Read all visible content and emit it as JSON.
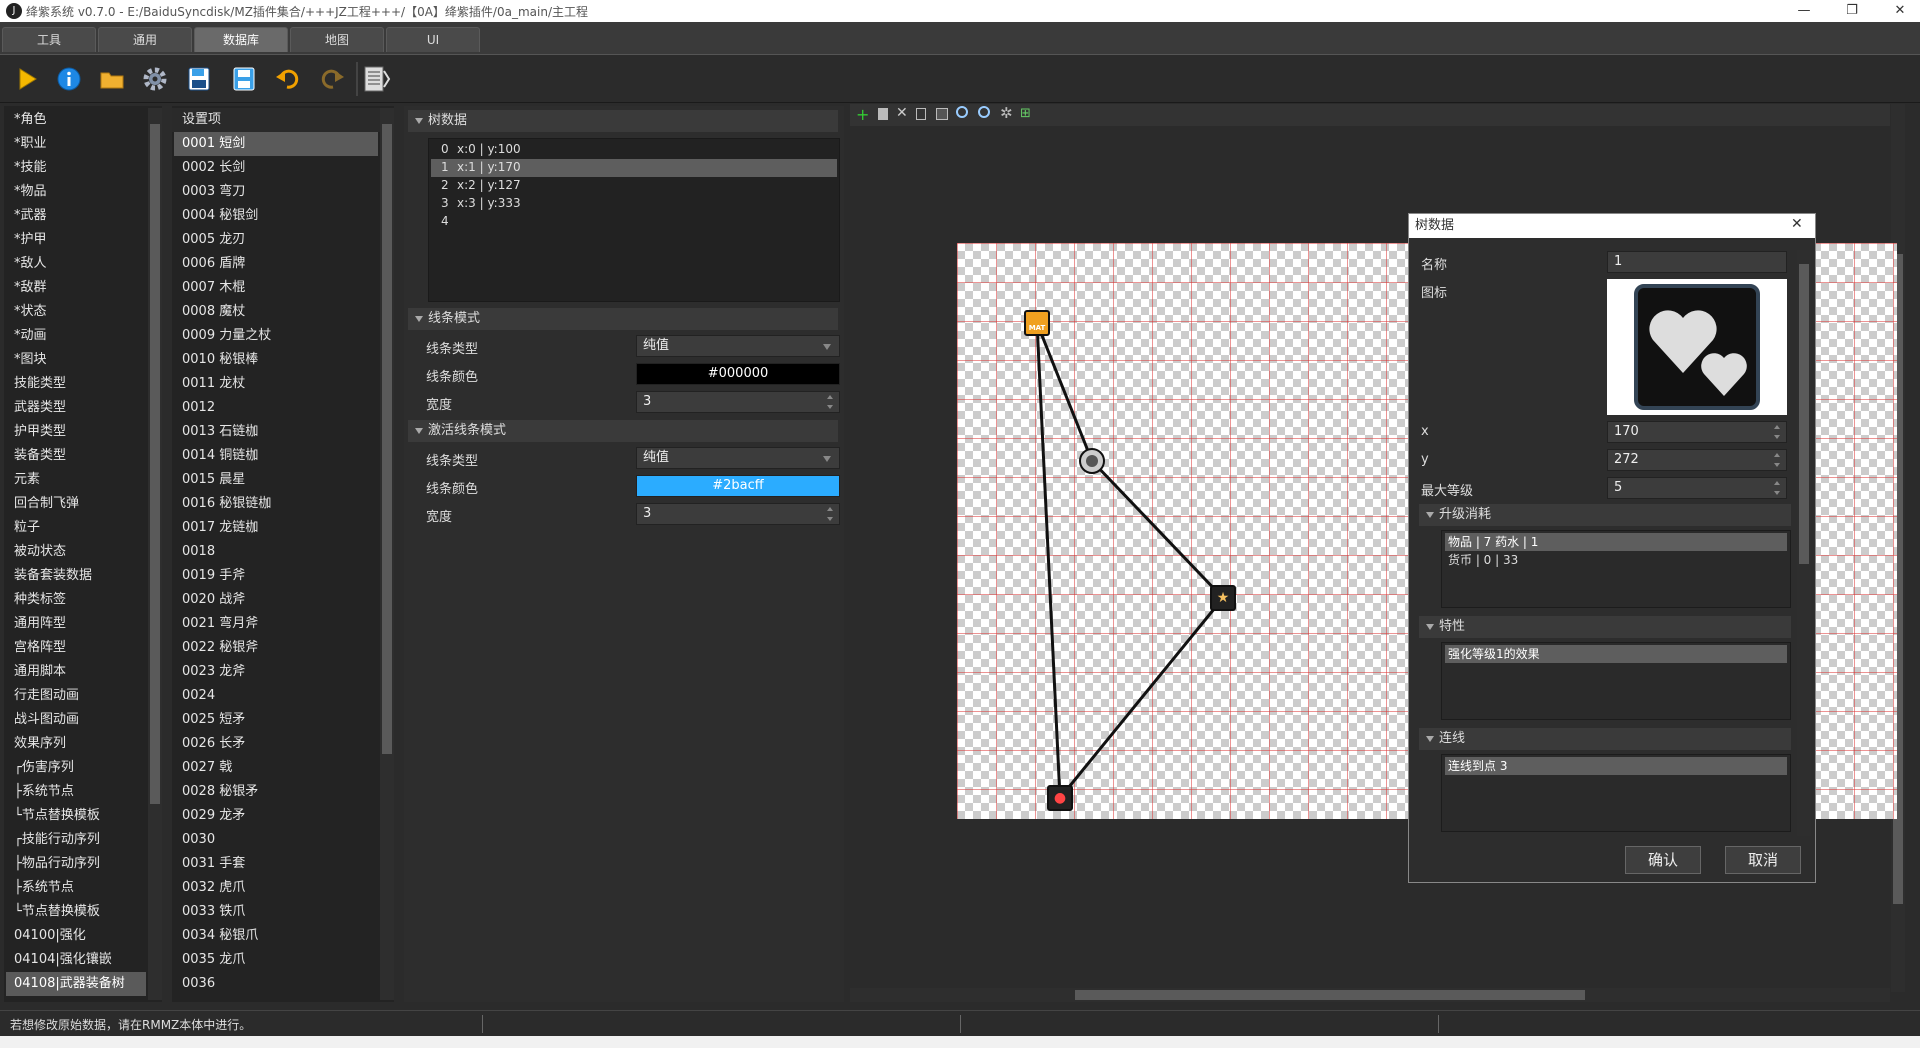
{
  "window": {
    "title": "绛紫系统 v0.7.0 - E:/BaiduSyncdisk/MZ插件集合/+++JZ工程+++/【0A】绛紫插件/0a_main/主工程",
    "logo_text": "J",
    "minimize": "—",
    "maximize": "❐",
    "close": "✕"
  },
  "tabs": [
    {
      "label": "工具",
      "active": false
    },
    {
      "label": "通用",
      "active": false
    },
    {
      "label": "数据库",
      "active": true
    },
    {
      "label": "地图",
      "active": false
    },
    {
      "label": "UI",
      "active": false
    }
  ],
  "toolbar": {
    "icons": [
      "play-icon",
      "info-icon",
      "folder-icon",
      "gear-icon",
      "save-as-icon",
      "save-icon",
      "undo-icon",
      "redo-icon",
      "script-icon"
    ],
    "colors": {
      "play": "#f5b800",
      "info": "#1e88e5",
      "folder": "#f0b030",
      "gear": "#b0b8c8",
      "save": "#3aa0e8",
      "undo": "#f0a000"
    }
  },
  "categories": [
    "*角色",
    "*职业",
    "*技能",
    "*物品",
    "*武器",
    "*护甲",
    "*敌人",
    "*敌群",
    "*状态",
    "*动画",
    "*图块",
    "技能类型",
    "武器类型",
    "护甲类型",
    "装备类型",
    "元素",
    "回合制飞弹",
    "粒子",
    "被动状态",
    "装备套装数据",
    "种类标签",
    "通用阵型",
    "宫格阵型",
    "通用脚本",
    "行走图动画",
    "战斗图动画",
    "效果序列",
    "┌伤害序列",
    "├系统节点",
    "└节点替换模板",
    "┌技能行动序列",
    "├物品行动序列",
    "├系统节点",
    "└节点替换模板",
    "04100|强化",
    "04104|强化镶嵌",
    "04108|武器装备树"
  ],
  "categories_selected": 36,
  "settings": {
    "header": "设置项",
    "items": [
      "0001  短剑",
      "0002  长剑",
      "0003  弯刀",
      "0004  秘银剑",
      "0005  龙刃",
      "0006  盾牌",
      "0007  木棍",
      "0008  魔杖",
      "0009  力量之杖",
      "0010  秘银棒",
      "0011  龙杖",
      "0012",
      "0013  石链枷",
      "0014  铜链枷",
      "0015  晨星",
      "0016  秘银链枷",
      "0017  龙链枷",
      "0018",
      "0019  手斧",
      "0020  战斧",
      "0021  弯月斧",
      "0022  秘银斧",
      "0023  龙斧",
      "0024",
      "0025  短矛",
      "0026  长矛",
      "0027  戟",
      "0028  秘银矛",
      "0029  龙矛",
      "0030",
      "0031  手套",
      "0032  虎爪",
      "0033  铁爪",
      "0034  秘银爪",
      "0035  龙爪",
      "0036"
    ],
    "selected": 0
  },
  "tree_section": {
    "title": "树数据",
    "rows": [
      {
        "idx": "0",
        "text": "x:0 | y:100"
      },
      {
        "idx": "1",
        "text": "x:1 | y:170"
      },
      {
        "idx": "2",
        "text": "x:2 | y:127"
      },
      {
        "idx": "3",
        "text": "x:3 | y:333"
      },
      {
        "idx": "4",
        "text": ""
      }
    ],
    "selected": 1
  },
  "line_mode": {
    "title": "线条模式",
    "type_label": "线条类型",
    "type_value": "纯值",
    "color_label": "线条颜色",
    "color_value": "#000000",
    "color_swatch": "#000000",
    "width_label": "宽度",
    "width_value": "3"
  },
  "active_line_mode": {
    "title": "激活线条模式",
    "type_label": "线条类型",
    "type_value": "纯值",
    "color_label": "线条颜色",
    "color_value": "#2bacff",
    "color_swatch": "#2bacff",
    "width_label": "宽度",
    "width_value": "3"
  },
  "canvas_toolbar": [
    "add-icon",
    "delete-icon",
    "cut-icon",
    "copy-icon",
    "paste-icon",
    "zoom-in-icon",
    "zoom-out-icon",
    "settings-icon",
    "fit-icon"
  ],
  "node_labels": {
    "node1": "MAT"
  },
  "dialog": {
    "title": "树数据",
    "close": "✕",
    "name_label": "名称",
    "name_value": "1",
    "icon_label": "图标",
    "x_label": "x",
    "x_value": "170",
    "y_label": "y",
    "y_value": "272",
    "max_level_label": "最大等级",
    "max_level_value": "5",
    "upgrade_cost": {
      "title": "升级消耗",
      "rows": [
        "物品 | 7 药水 | 1",
        "货币 | 0 | 33"
      ]
    },
    "traits": {
      "title": "特性",
      "rows": [
        "强化等级1的效果"
      ]
    },
    "links": {
      "title": "连线",
      "rows": [
        "连线到点 3"
      ]
    },
    "confirm": "确认",
    "cancel": "取消"
  },
  "status": {
    "message": "若想修改原始数据，请在RMMZ本体中进行。"
  }
}
